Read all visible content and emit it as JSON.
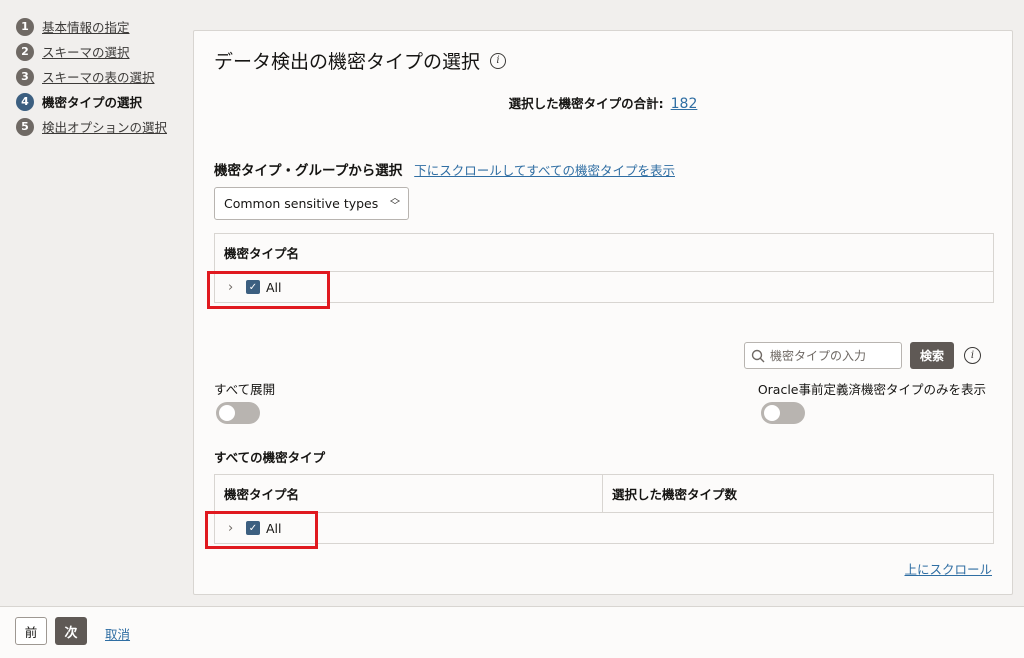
{
  "steps": [
    {
      "num": "1",
      "label": "基本情報の指定"
    },
    {
      "num": "2",
      "label": "スキーマの選択"
    },
    {
      "num": "3",
      "label": "スキーマの表の選択"
    },
    {
      "num": "4",
      "label": "機密タイプの選択"
    },
    {
      "num": "5",
      "label": "検出オプションの選択"
    }
  ],
  "panel": {
    "title": "データ検出の機密タイプの選択",
    "total_label": "選択した機密タイプの合計:",
    "total_value": "182",
    "group_heading": "機密タイプ・グループから選択",
    "group_scroll_link": "下にスクロールしてすべての機密タイプを表示",
    "group_select_value": "Common sensitive types",
    "table1": {
      "header": "機密タイプ名",
      "row_label": "All"
    },
    "search": {
      "placeholder": "機密タイプの入力",
      "button": "検索"
    },
    "expand_all_label": "すべて展開",
    "oracle_only_label": "Oracle事前定義済機密タイプのみを表示",
    "all_types_heading": "すべての機密タイプ",
    "table2": {
      "header_name": "機密タイプ名",
      "header_count": "選択した機密タイプ数",
      "row_label": "All"
    },
    "scroll_up_link": "上にスクロール"
  },
  "footer": {
    "prev": "前",
    "next": "次",
    "cancel": "取消"
  },
  "colors": {
    "accent": "#3c5f80",
    "link": "#2f6ea3",
    "highlight": "#e0191f",
    "button_dark": "#5f5955"
  }
}
